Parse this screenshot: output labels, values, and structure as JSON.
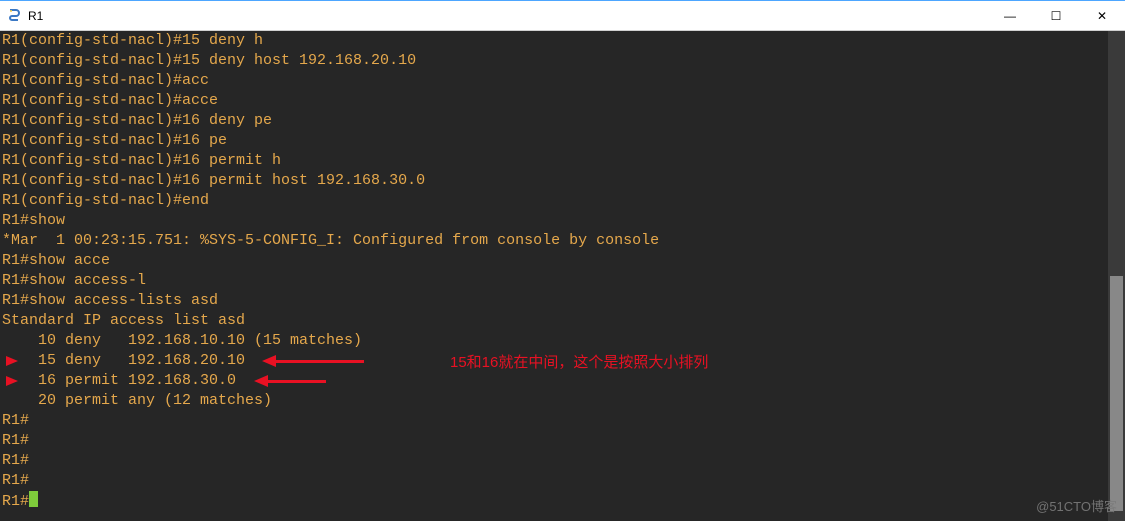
{
  "window": {
    "title": "R1",
    "icon": "snake-icon"
  },
  "controls": {
    "minimize": "—",
    "maximize": "☐",
    "close": "✕"
  },
  "terminal": {
    "lines": [
      "R1(config-std-nacl)#15 deny h",
      "R1(config-std-nacl)#15 deny host 192.168.20.10",
      "R1(config-std-nacl)#acc",
      "R1(config-std-nacl)#acce",
      "R1(config-std-nacl)#16 deny pe",
      "R1(config-std-nacl)#16 pe",
      "R1(config-std-nacl)#16 permit h",
      "R1(config-std-nacl)#16 permit host 192.168.30.0",
      "R1(config-std-nacl)#end",
      "R1#show ",
      "*Mar  1 00:23:15.751: %SYS-5-CONFIG_I: Configured from console by console",
      "R1#show acce",
      "R1#show access-l",
      "R1#show access-lists asd",
      "Standard IP access list asd",
      "    10 deny   192.168.10.10 (15 matches)",
      "    15 deny   192.168.20.10",
      "    16 permit 192.168.30.0",
      "    20 permit any (12 matches)",
      "R1#",
      "R1#",
      "R1#",
      "R1#",
      "R1#"
    ],
    "cursor_on_last": true
  },
  "annotation": {
    "text": "15和16就在中间，这个是按照大小排列",
    "arrows": [
      {
        "target_line_index": 16
      },
      {
        "target_line_index": 17
      }
    ]
  },
  "scrollbar": {
    "thumb_top_pct": 50,
    "thumb_height_pct": 48
  },
  "watermark": "@51CTO博客"
}
